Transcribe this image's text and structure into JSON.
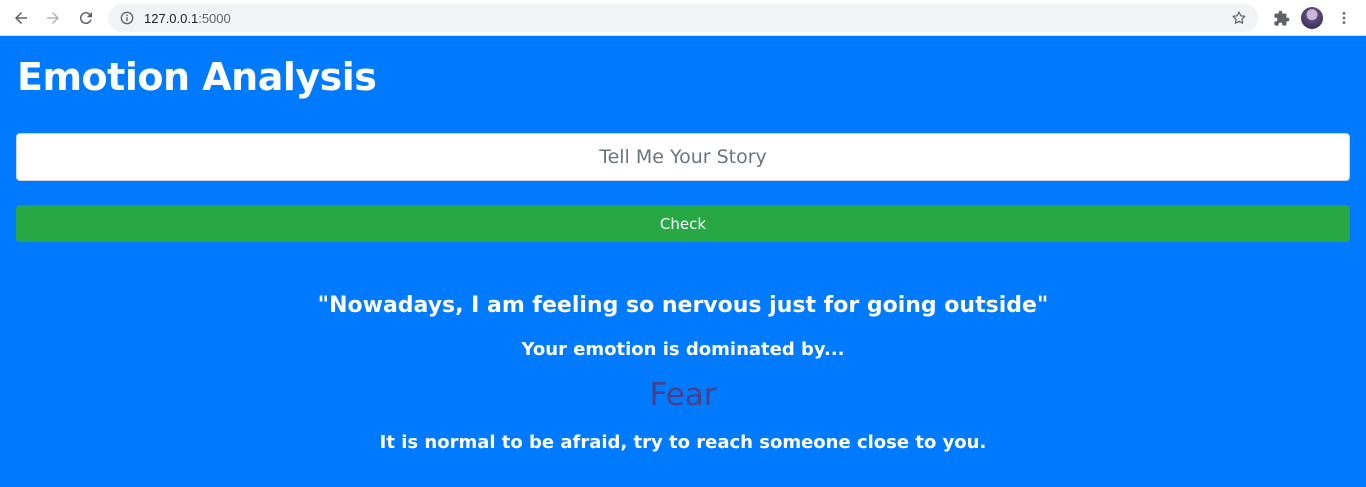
{
  "browser": {
    "url_host": "127.0.0.1",
    "url_port": ":5000"
  },
  "page": {
    "title": "Emotion Analysis",
    "story_placeholder": "Tell Me Your Story",
    "check_label": "Check"
  },
  "result": {
    "quote": "\"Nowadays, I am feeling so nervous just for going outside\"",
    "dominated_label": "Your emotion is dominated by...",
    "emotion": "Fear",
    "emotion_color": "#4b3f86",
    "advice": "It is normal to be afraid, try to reach someone close to you."
  },
  "colors": {
    "background": "#007bff",
    "button": "#28a745"
  }
}
